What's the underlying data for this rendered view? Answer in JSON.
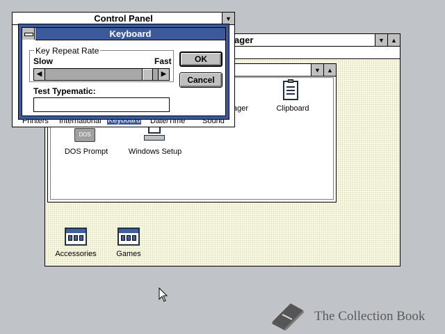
{
  "program_manager": {
    "title_partial": "ager"
  },
  "main_group": {
    "items": [
      {
        "label": "Clipboard"
      },
      {
        "label": "ager"
      },
      {
        "label": "DOS Prompt"
      },
      {
        "label": "Windows Setup"
      }
    ],
    "dos_icon_text": "DOS"
  },
  "groups": [
    {
      "label": "Accessories"
    },
    {
      "label": "Games"
    }
  ],
  "control_panel": {
    "title": "Control Panel",
    "items": [
      {
        "label": "Printers"
      },
      {
        "label": "International"
      },
      {
        "label": "Keyboard"
      },
      {
        "label": "Date/Time"
      },
      {
        "label": "Sound"
      }
    ]
  },
  "keyboard_dialog": {
    "title": "Keyboard",
    "group_label": "Key Repeat Rate",
    "slow_label": "Slow",
    "fast_label": "Fast",
    "repeat_rate_fraction": 0.96,
    "test_label": "Test Typematic:",
    "test_value": "",
    "ok_label": "OK",
    "cancel_label": "Cancel"
  },
  "watermark": {
    "text": "The Collection Book"
  },
  "colors": {
    "desktop": "#c0c4c8",
    "active_title": "#3c5a9a",
    "group_bg": "#fbfbe6"
  }
}
